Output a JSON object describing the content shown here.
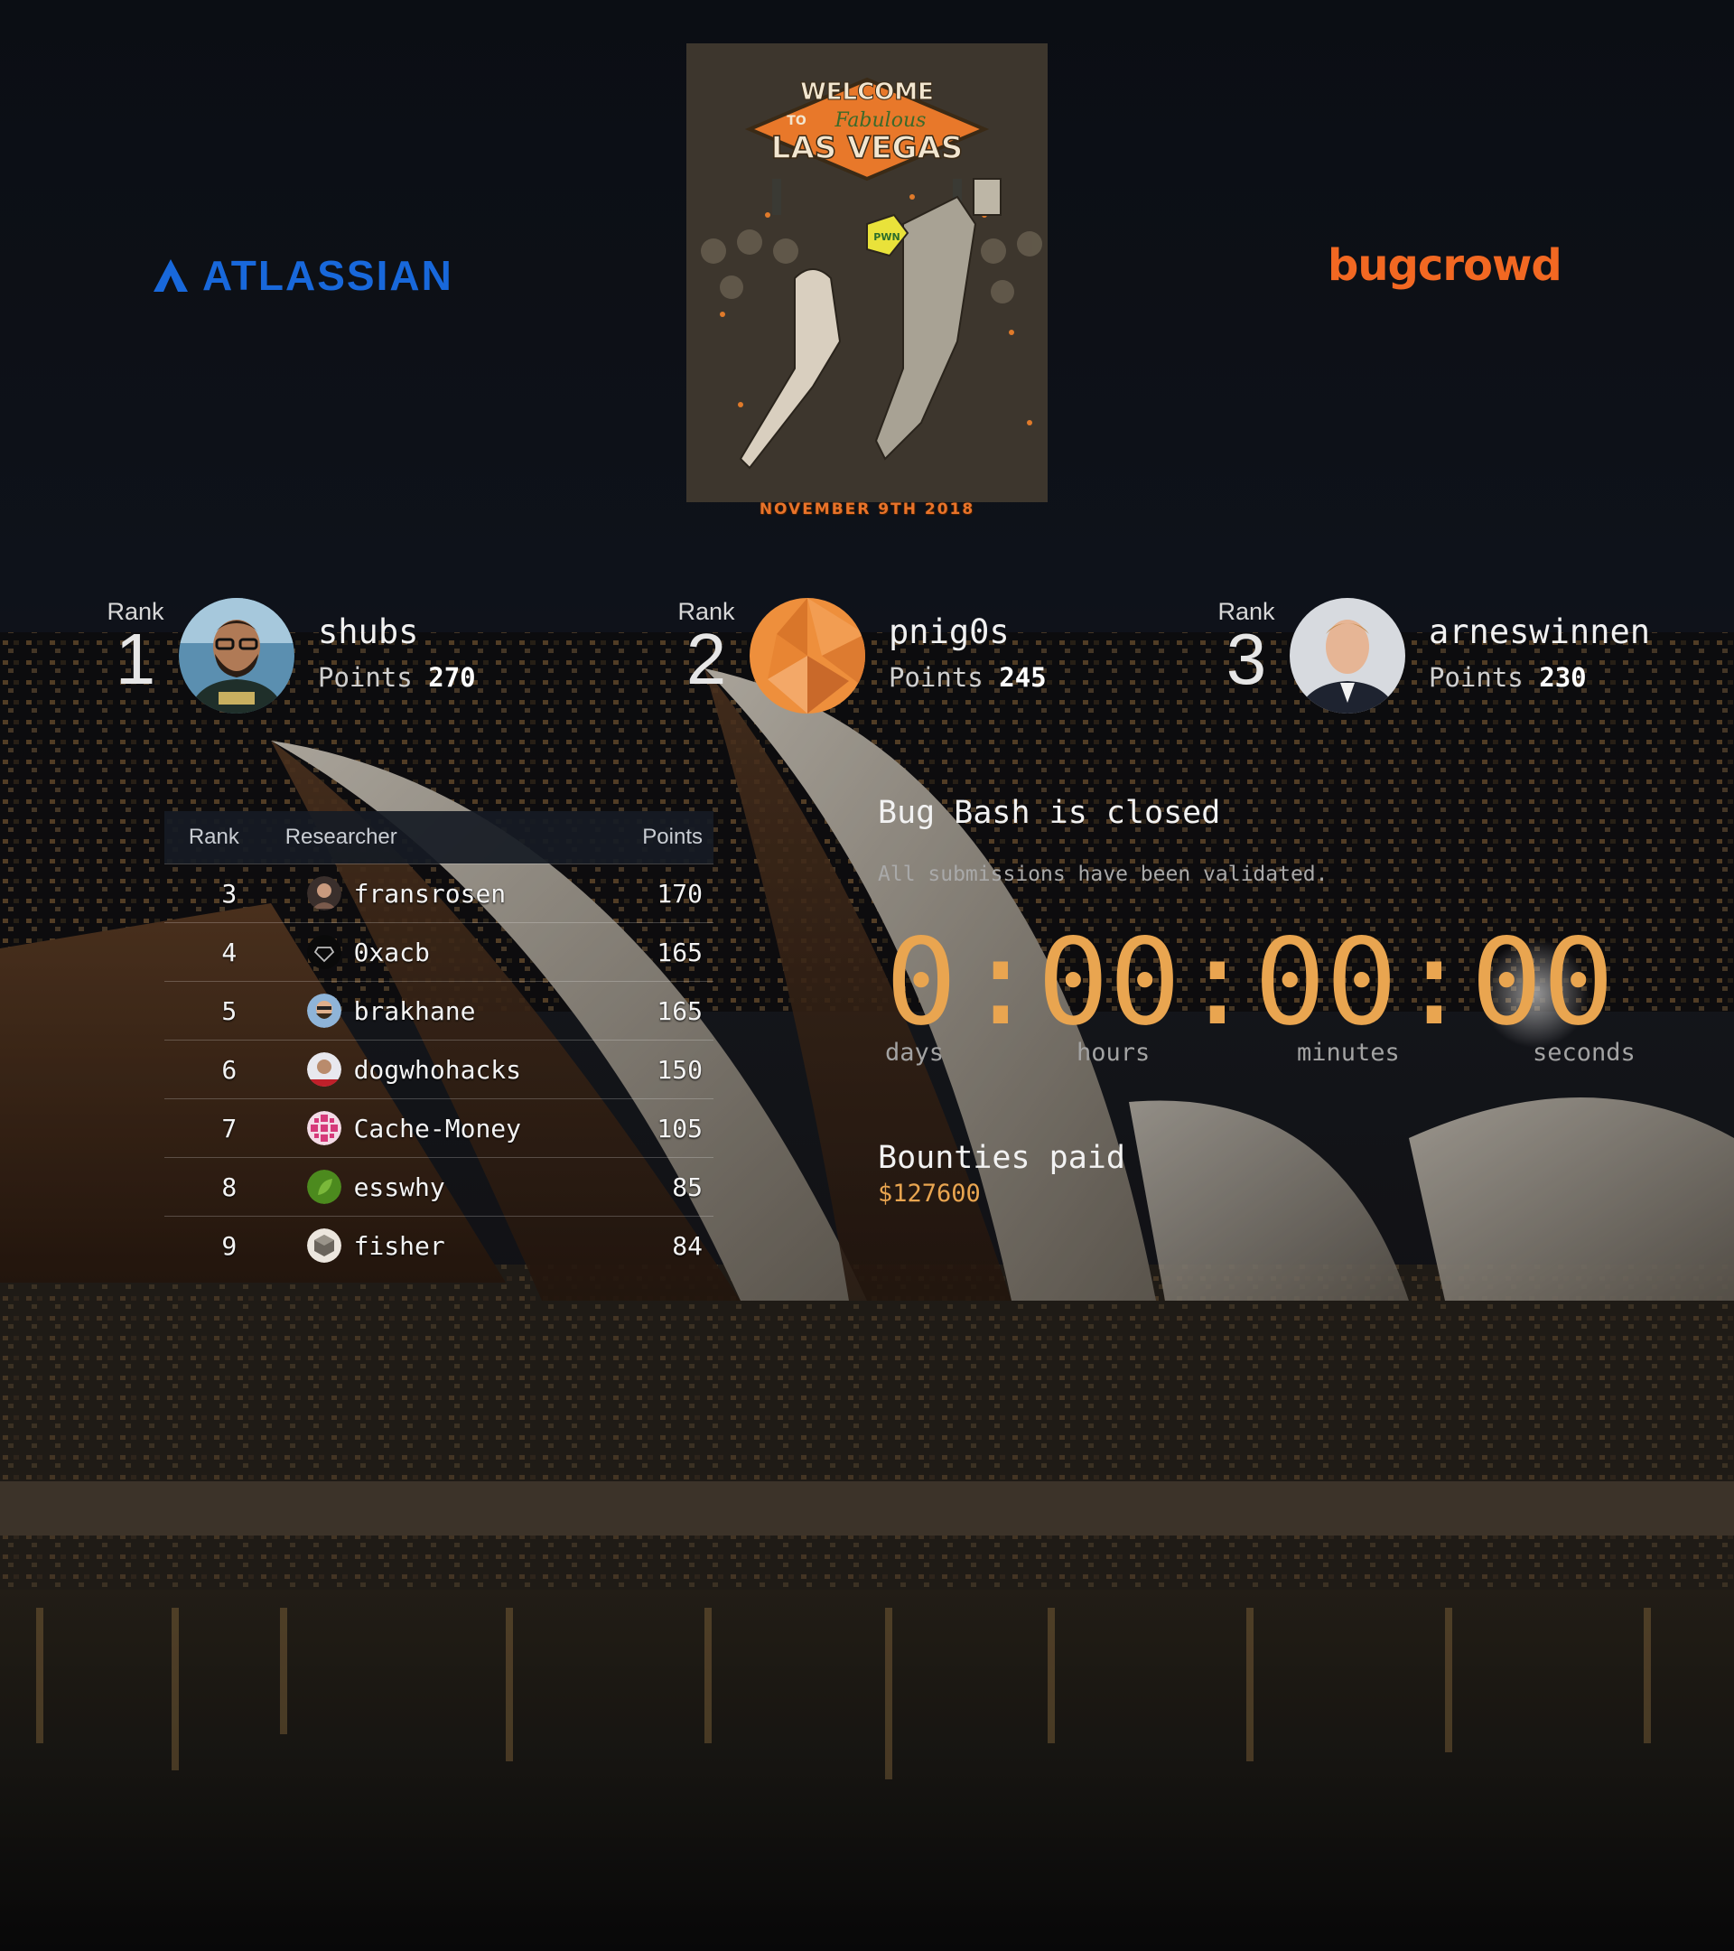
{
  "sponsors": {
    "left": "ATLASSIAN",
    "right": "bugcrowd"
  },
  "poster": {
    "line1": "WELCOME",
    "line2": "TO",
    "line3": "Fabulous",
    "line4": "LAS VEGAS",
    "badge": "PWN",
    "date": "NOVEMBER 9TH 2018"
  },
  "podium": [
    {
      "rank_label": "Rank",
      "rank": "1",
      "name": "shubs",
      "points_label": "Points",
      "points": "270"
    },
    {
      "rank_label": "Rank",
      "rank": "2",
      "name": "pnig0s",
      "points_label": "Points",
      "points": "245"
    },
    {
      "rank_label": "Rank",
      "rank": "3",
      "name": "arneswinnen",
      "points_label": "Points",
      "points": "230"
    }
  ],
  "leaderboard": {
    "headers": {
      "rank": "Rank",
      "researcher": "Researcher",
      "points": "Points"
    },
    "rows": [
      {
        "rank": "3",
        "name": "fransrosen",
        "points": "170"
      },
      {
        "rank": "4",
        "name": "0xacb",
        "points": "165"
      },
      {
        "rank": "5",
        "name": "brakhane",
        "points": "165"
      },
      {
        "rank": "6",
        "name": "dogwhohacks",
        "points": "150"
      },
      {
        "rank": "7",
        "name": "Cache-Money",
        "points": "105"
      },
      {
        "rank": "8",
        "name": "esswhy",
        "points": "85"
      },
      {
        "rank": "9",
        "name": "fisher",
        "points": "84"
      }
    ]
  },
  "status": {
    "title": "Bug Bash is closed",
    "subtitle": "All submissions have been validated."
  },
  "countdown": {
    "days": "0",
    "hours": "00",
    "minutes": "00",
    "seconds": "00",
    "separator": ":",
    "labels": {
      "days": "days",
      "hours": "hours",
      "minutes": "minutes",
      "seconds": "seconds"
    }
  },
  "bounties": {
    "title": "Bounties paid",
    "value": "$127600"
  },
  "colors": {
    "accent": "#e9a550",
    "atlassian": "#1868db",
    "bugcrowd": "#f26822",
    "background": "#0d1016"
  }
}
